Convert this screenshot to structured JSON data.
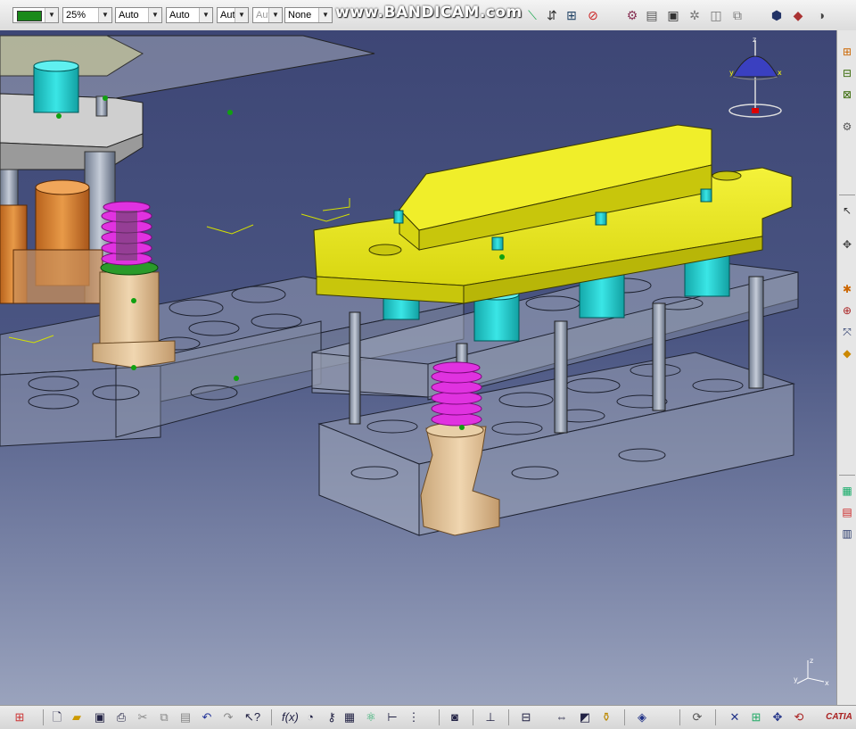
{
  "toolbar": {
    "color_swatch": "#1a8a1a",
    "transparency": "25%",
    "line_thickness": "Auto",
    "line_type": "Auto",
    "point_symbol": "Aut",
    "rendering_style": "Aut",
    "layer": "None"
  },
  "watermark": "www.BANDICAM.com",
  "compass_axes": {
    "z": "z",
    "y": "y",
    "x": "x"
  },
  "triad": {
    "z": "z",
    "y": "y",
    "x": "x"
  },
  "brand": "CATIA",
  "colors": {
    "viewport_top": "#3d4675",
    "viewport_bottom": "#9aa3bd",
    "punch_holder": "#e8e61e",
    "guide_bushing": "#2fd4d4",
    "spring": "#e032e0",
    "stripper_bolt": "#e2c39a",
    "plate_transparent": "#9aa2b4"
  },
  "icons": {
    "top": [
      "hide-show-icon",
      "swap-space-icon",
      "measure-icon",
      "apply-material-icon",
      "no-material-icon",
      "tools-palette-icon",
      "catalog-icon",
      "update-icon",
      "screen-capture-icon",
      "cube-view-icon",
      "view-mode-icon"
    ],
    "right": [
      "assembly-constraint-icon",
      "product-icon",
      "insert-component-icon",
      "select-arrow-icon",
      "snap-icon",
      "manipulate-icon",
      "explode-icon",
      "move-icon",
      "clash-icon",
      "section-icon",
      "bom-icon",
      "catalog-browser-icon",
      "scene-icon"
    ],
    "bottom": [
      "new-file-icon",
      "open-file-icon",
      "save-icon",
      "print-icon",
      "cut-icon",
      "copy-icon",
      "paste-icon",
      "undo-icon",
      "redo-icon",
      "whats-this-icon",
      "formula-icon",
      "knowledge-icon",
      "table-icon",
      "tree-icon",
      "parameters-icon",
      "photo-icon",
      "fixed-together-icon",
      "layout-icon",
      "distance-icon",
      "measure-item-icon",
      "inertia-icon",
      "fly-mode-icon",
      "refresh-icon",
      "fit-all-icon",
      "pan-icon",
      "rotate-icon",
      "zoom-icon",
      "catalia-logo-icon"
    ]
  }
}
